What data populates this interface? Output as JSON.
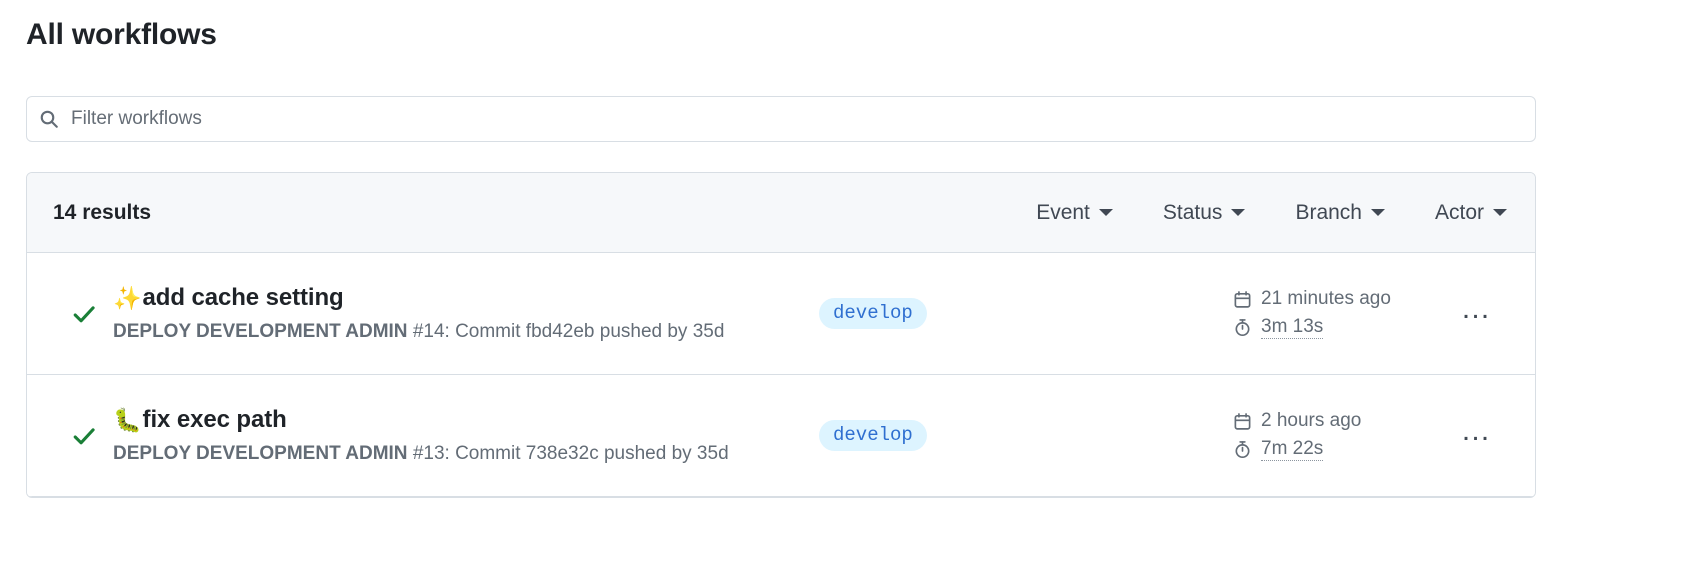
{
  "page": {
    "title": "All workflows"
  },
  "search": {
    "placeholder": "Filter workflows",
    "value": "",
    "icon": "search-icon"
  },
  "results": {
    "count_label": "14 results",
    "filters": [
      {
        "label": "Event",
        "icon": "chevron-down-icon"
      },
      {
        "label": "Status",
        "icon": "chevron-down-icon"
      },
      {
        "label": "Branch",
        "icon": "chevron-down-icon"
      },
      {
        "label": "Actor",
        "icon": "chevron-down-icon"
      }
    ]
  },
  "runs": [
    {
      "status_icon": "check-icon",
      "status_color": "#1a7f37",
      "emoji": "✨",
      "emoji_name": "sparkles-emoji",
      "title": "add cache setting",
      "workflow_name": "DEPLOY DEVELOPMENT ADMIN",
      "run_details": "#14: Commit fbd42eb pushed by 35d",
      "branch": "develop",
      "branch_color": "#2f6fd0",
      "branch_bg": "#ddf4ff",
      "time_icon": "calendar-icon",
      "time_ago": "21 minutes ago",
      "duration_icon": "stopwatch-icon",
      "duration": "3m 13s",
      "menu_label": "…",
      "menu_name": "kebab-menu-icon"
    },
    {
      "status_icon": "check-icon",
      "status_color": "#1a7f37",
      "emoji": "🐛",
      "emoji_name": "bug-emoji",
      "title": "fix exec path",
      "workflow_name": "DEPLOY DEVELOPMENT ADMIN",
      "run_details": "#13: Commit 738e32c pushed by 35d",
      "branch": "develop",
      "branch_color": "#2f6fd0",
      "branch_bg": "#ddf4ff",
      "time_icon": "calendar-icon",
      "time_ago": "2 hours ago",
      "duration_icon": "stopwatch-icon",
      "duration": "7m 22s",
      "menu_label": "…",
      "menu_name": "kebab-menu-icon"
    }
  ]
}
